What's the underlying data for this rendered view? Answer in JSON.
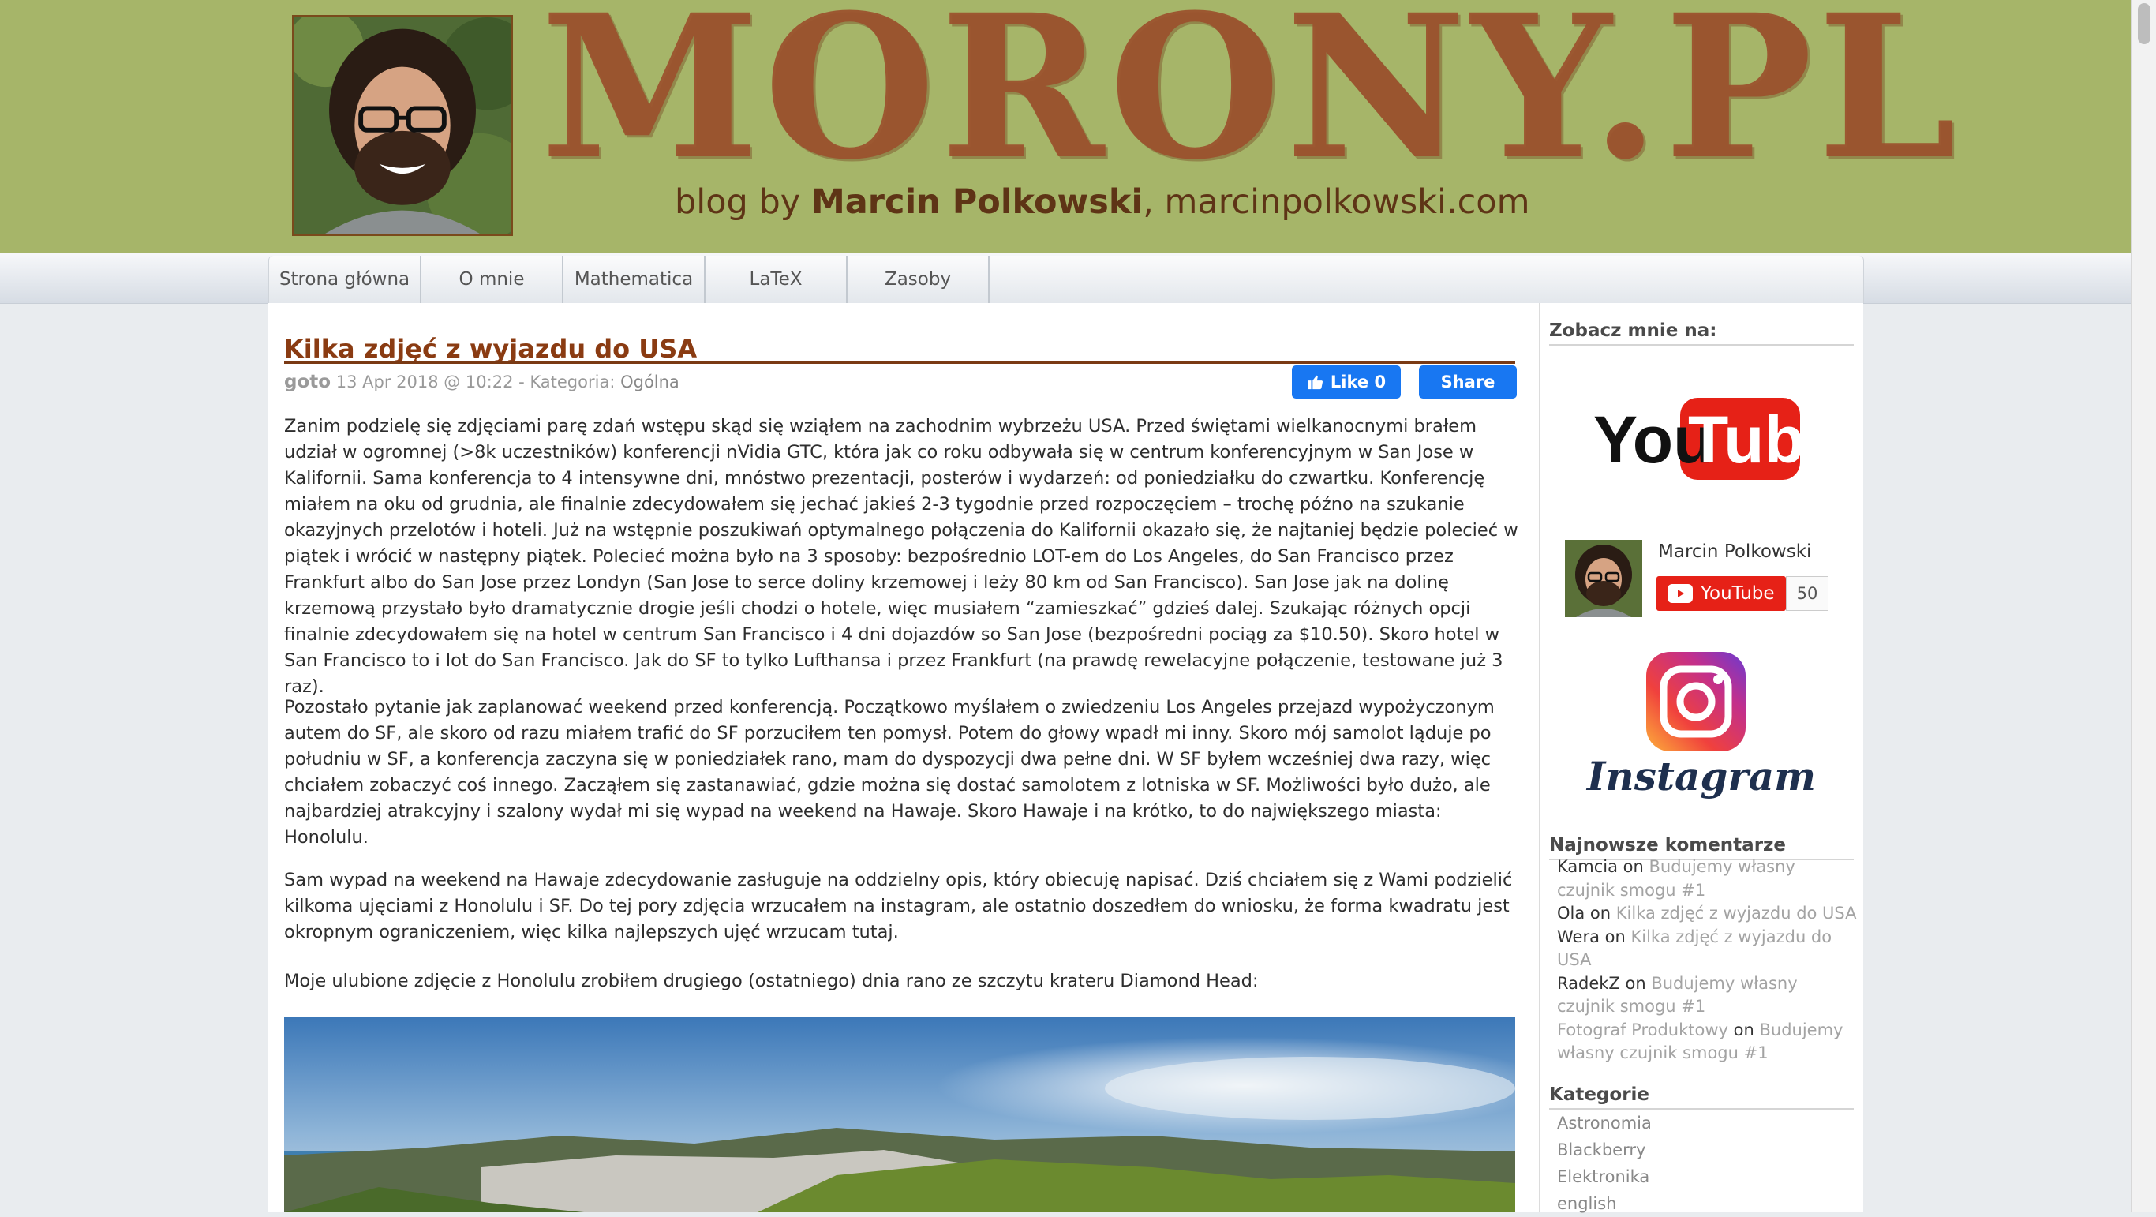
{
  "header": {
    "logo_text": "MORONY.PL",
    "tagline_prefix": "blog by ",
    "tagline_name": "Marcin Polkowski",
    "tagline_suffix": ", marcinpolkowski.com"
  },
  "nav": {
    "items": [
      {
        "label": "Strona główna"
      },
      {
        "label": "O mnie"
      },
      {
        "label": "Mathematica"
      },
      {
        "label": "LaTeX"
      },
      {
        "label": "Zasoby"
      }
    ]
  },
  "post": {
    "title": "Kilka zdjęć z wyjazdu do USA",
    "author": "goto",
    "date": " 13 Apr 2018 @ 10:22 - Kategoria: ",
    "category": "Ogólna",
    "like_label": "Like 0",
    "share_label": "Share",
    "paragraphs": [
      "Zanim podzielę się zdjęciami parę zdań wstępu skąd się wziąłem na zachodnim wybrzeżu USA. Przed świętami wielkanocnymi brałem udział w ogromnej (>8k uczestników) konferencji nVidia GTC, która jak co roku odbywała się w centrum konferencyjnym w San Jose w Kalifornii. Sama konferencja to 4 intensywne dni, mnóstwo prezentacji, posterów i wydarzeń: od poniedziałku do czwartku. Konferencję miałem na oku od grudnia, ale finalnie zdecydowałem się jechać jakieś 2-3 tygodnie przed rozpoczęciem – trochę późno na szukanie okazyjnych przelotów i hoteli. Już na wstępnie poszukiwań optymalnego połączenia do Kalifornii okazało się, że najtaniej będzie polecieć w piątek i wrócić w następny piątek. Polecieć można było na 3 sposoby: bezpośrednio LOT-em do Los Angeles, do San Francisco przez Frankfurt albo do San Jose przez Londyn (San Jose to serce doliny krzemowej i leży 80 km od San Francisco). San Jose jak na dolinę krzemową przystało było dramatycznie drogie jeśli chodzi o hotele, więc musiałem “zamieszkać” gdzieś dalej. Szukając różnych opcji finalnie zdecydowałem się na hotel w centrum San Francisco i 4 dni dojazdów so San Jose (bezpośredni pociąg za $10.50). Skoro hotel w San Francisco to i lot do San Francisco. Jak do SF to tylko Lufthansa i przez Frankfurt (na prawdę rewelacyjne połączenie, testowane już 3 raz).",
      "Pozostało pytanie jak zaplanować weekend przed konferencją. Początkowo myślałem o zwiedzeniu Los Angeles przejazd wypożyczonym autem do SF, ale skoro od razu miałem trafić do SF porzuciłem ten pomysł. Potem do głowy wpadł mi inny. Skoro mój samolot ląduje po południu w SF, a konferencja zaczyna się w poniedziałek rano, mam do dyspozycji dwa pełne dni. W SF byłem wcześniej dwa razy, więc chciałem zobaczyć coś innego. Zacząłem się zastanawiać, gdzie można się dostać samolotem z lotniska w SF. Możliwości było dużo, ale najbardziej atrakcyjny i szalony wydał mi się wypad na weekend na Hawaje. Skoro Hawaje i na krótko, to do największego miasta: Honolulu.",
      "Sam wypad na weekend na Hawaje zdecydowanie zasługuje na oddzielny opis, który obiecuję napisać. Dziś chciałem się z Wami podzielić kilkoma ujęciami z Honolulu i SF. Do tej pory zdjęcia wrzucałem na instagram, ale ostatnio doszedłem do wniosku, że forma kwadratu jest okropnym ograniczeniem, więc kilka najlepszych ujęć wrzucam tutaj.",
      "Moje ulubione zdjęcie z Honolulu zrobiłem drugiego (ostatniego) dnia rano ze szczytu krateru Diamond Head:"
    ]
  },
  "sidebar": {
    "see_me_heading": "Zobacz mnie na:",
    "youtube_word_you": "You",
    "youtube_word_tube": "Tube",
    "channel_name": "Marcin Polkowski",
    "subscribe_label": "YouTube",
    "subscriber_count": "50",
    "instagram_word": "Instagram",
    "comments_heading": "Najnowsze komentarze",
    "comments": [
      {
        "author": "Kamcia",
        "on": " on ",
        "post": "Budujemy własny czujnik smogu #1"
      },
      {
        "author": "Ola",
        "on": " on ",
        "post": "Kilka zdjęć z wyjazdu do USA"
      },
      {
        "author": "Wera",
        "on": " on ",
        "post": "Kilka zdjęć z wyjazdu do USA"
      },
      {
        "author": "RadekZ",
        "on": " on ",
        "post": "Budujemy własny czujnik smogu #1"
      },
      {
        "author": "Fotograf Produktowy",
        "on": " on ",
        "post": "Budujemy własny czujnik smogu #1"
      }
    ],
    "categories_heading": "Kategorie",
    "categories": [
      "Astronomia",
      "Blackberry",
      "Elektronika",
      "english"
    ]
  },
  "colors": {
    "header_bg": "#a6b569",
    "logo": "#9b502d",
    "title": "#8a3b12",
    "facebook": "#1877f2",
    "youtube_red": "#e62117"
  }
}
